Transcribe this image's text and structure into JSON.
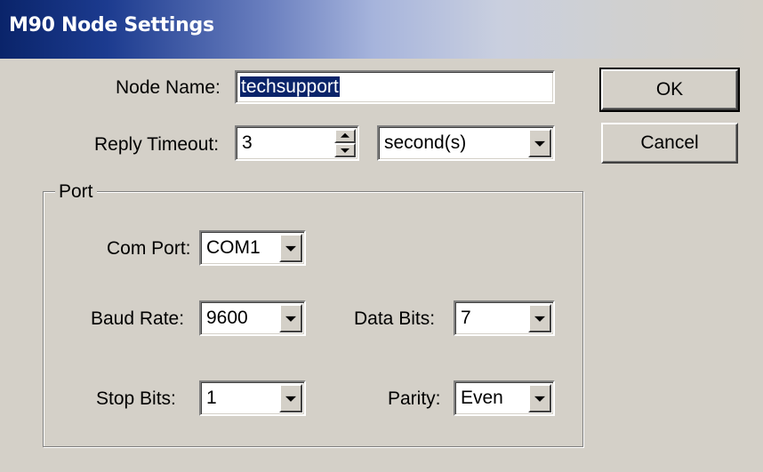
{
  "window": {
    "title": "M90 Node Settings"
  },
  "form": {
    "node_name_label": "Node Name:",
    "node_name_value": "techsupport",
    "reply_timeout_label": "Reply Timeout:",
    "reply_timeout_value": "3",
    "timeout_unit_value": "second(s)"
  },
  "port": {
    "group_label": "Port",
    "com_port_label": "Com Port:",
    "com_port_value": "COM1",
    "baud_rate_label": "Baud Rate:",
    "baud_rate_value": "9600",
    "data_bits_label": "Data Bits:",
    "data_bits_value": "7",
    "stop_bits_label": "Stop Bits:",
    "stop_bits_value": "1",
    "parity_label": "Parity:",
    "parity_value": "Even"
  },
  "buttons": {
    "ok_label": "OK",
    "cancel_label": "Cancel"
  },
  "colors": {
    "titlebar_start": "#0a246a",
    "face": "#d4d0c8",
    "selection": "#0a246a"
  }
}
